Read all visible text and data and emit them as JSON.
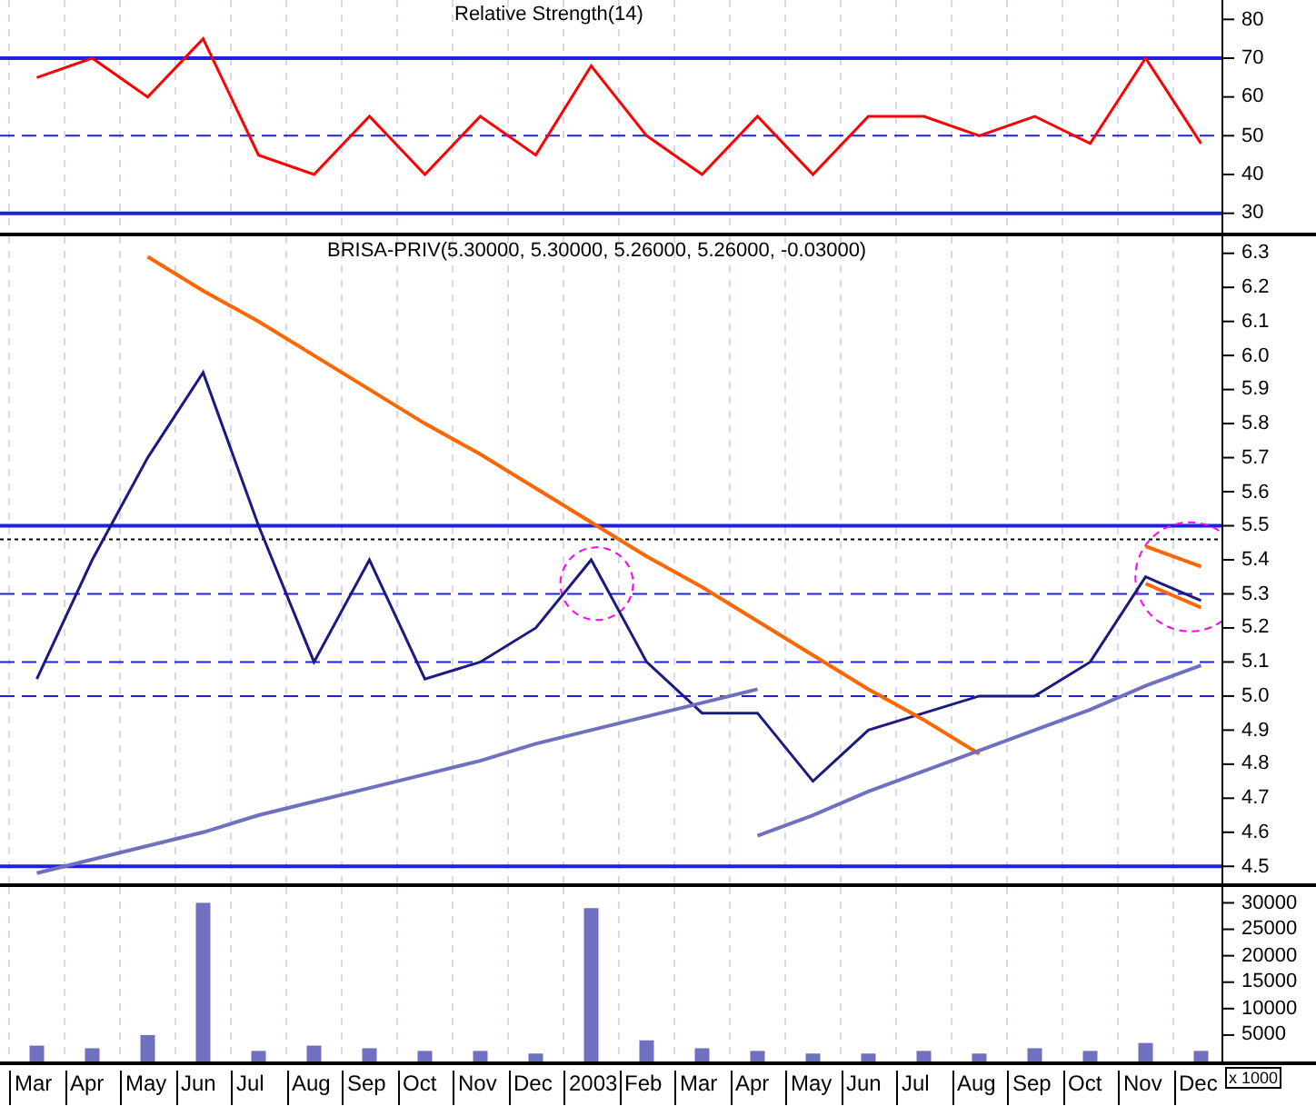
{
  "months": [
    "Mar",
    "Apr",
    "May",
    "Jun",
    "Jul",
    "Aug",
    "Sep",
    "Oct",
    "Nov",
    "Dec",
    "2003",
    "Feb",
    "Mar",
    "Apr",
    "May",
    "Jun",
    "Jul",
    "Aug",
    "Sep",
    "Oct",
    "Nov",
    "Dec"
  ],
  "rsi_panel": {
    "chart_data": {
      "type": "line",
      "title": "Relative Strength(14)",
      "ylim": [
        25,
        85
      ],
      "yticks": [
        30,
        40,
        50,
        60,
        70,
        80
      ],
      "grid": true,
      "ref_lines": [
        {
          "axis": "y",
          "value": 70
        },
        {
          "axis": "y",
          "value": 50
        },
        {
          "axis": "y",
          "value": 30
        }
      ],
      "series": [
        {
          "color": "#ff0000",
          "values": [
            65,
            70,
            60,
            75,
            45,
            40,
            55,
            40,
            55,
            45,
            68,
            50,
            40,
            55,
            40,
            55,
            55,
            50,
            55,
            48,
            70,
            48
          ]
        }
      ]
    }
  },
  "price_panel": {
    "chart_data": {
      "type": "line",
      "title": "BRISA-PRIV(5.30000, 5.30000, 5.26000, 5.26000, -0.03000)",
      "ylim": [
        4.45,
        6.35
      ],
      "yticks": [
        {
          "value": 4.5,
          "label": "4.5"
        },
        {
          "value": 4.6,
          "label": "4.6"
        },
        {
          "value": 4.7,
          "label": "4.7"
        },
        {
          "value": 4.8,
          "label": "4.8"
        },
        {
          "value": 4.9,
          "label": "4.9"
        },
        {
          "value": 5.0,
          "label": "5.0"
        },
        {
          "value": 5.1,
          "label": "5.1"
        },
        {
          "value": 5.2,
          "label": "5.2"
        },
        {
          "value": 5.3,
          "label": "5.3"
        },
        {
          "value": 5.4,
          "label": "5.4"
        },
        {
          "value": 5.5,
          "label": "5.5"
        },
        {
          "value": 5.6,
          "label": "5.6"
        },
        {
          "value": 5.7,
          "label": "5.7"
        },
        {
          "value": 5.8,
          "label": "5.8"
        },
        {
          "value": 5.9,
          "label": "5.9"
        },
        {
          "value": 6.0,
          "label": "6.0"
        },
        {
          "value": 6.1,
          "label": "6.1"
        },
        {
          "value": 6.2,
          "label": "6.2"
        },
        {
          "value": 6.3,
          "label": "6.3"
        }
      ],
      "grid": true,
      "ref_lines": [
        {
          "axis": "y",
          "value": 5.5
        },
        {
          "axis": "y",
          "value": 5.46
        },
        {
          "axis": "y",
          "value": 5.3
        },
        {
          "axis": "y",
          "value": 5.1
        },
        {
          "axis": "y",
          "value": 5.0
        },
        {
          "axis": "y",
          "value": 4.5
        }
      ],
      "series": [
        {
          "color": "#1a1a80",
          "values": [
            5.05,
            5.4,
            5.7,
            5.95,
            5.5,
            5.1,
            5.4,
            5.05,
            5.1,
            5.2,
            5.4,
            5.1,
            4.95,
            4.95,
            4.75,
            4.9,
            4.95,
            5.0,
            5.0,
            5.1,
            5.35,
            5.28
          ]
        },
        {
          "color": "#ff6600",
          "values": [
            null,
            null,
            6.29,
            6.19,
            6.1,
            6.0,
            5.9,
            5.8,
            5.71,
            5.61,
            5.51,
            5.41,
            5.32,
            5.22,
            5.12,
            5.02,
            4.93,
            4.83,
            null,
            null,
            null,
            null
          ]
        },
        {
          "color": "#7070c0",
          "values": [
            4.48,
            4.52,
            4.56,
            4.6,
            4.65,
            4.69,
            4.73,
            4.77,
            4.81,
            4.86,
            4.9,
            4.94,
            4.98,
            5.02,
            null,
            null,
            null,
            null,
            null,
            null,
            null,
            null
          ]
        },
        {
          "color": "#7070c0",
          "values": [
            null,
            null,
            null,
            null,
            null,
            null,
            null,
            null,
            null,
            null,
            null,
            null,
            null,
            4.59,
            4.65,
            4.72,
            4.78,
            4.84,
            4.9,
            4.96,
            5.03,
            5.09
          ]
        },
        {
          "color": "#ff6600",
          "values": [
            null,
            null,
            null,
            null,
            null,
            null,
            null,
            null,
            null,
            null,
            null,
            null,
            null,
            null,
            null,
            null,
            null,
            null,
            null,
            null,
            5.44,
            5.38
          ]
        },
        {
          "color": "#ff6600",
          "values": [
            null,
            null,
            null,
            null,
            null,
            null,
            null,
            null,
            null,
            null,
            null,
            null,
            null,
            null,
            null,
            null,
            null,
            null,
            null,
            null,
            5.33,
            5.26
          ]
        }
      ]
    }
  },
  "volume_panel": {
    "chart_data": {
      "type": "bar",
      "ylabel": "x 1000",
      "ylim": [
        0,
        33000
      ],
      "yticks": [
        5000,
        10000,
        15000,
        20000,
        25000,
        30000
      ],
      "grid": true,
      "series": [
        {
          "color": "#7070c0",
          "values": [
            3000,
            2500,
            5000,
            30000,
            2000,
            3000,
            2500,
            2000,
            2000,
            1500,
            29000,
            4000,
            2500,
            2000,
            1500,
            1500,
            2000,
            1500,
            2500,
            2000,
            3500,
            2000
          ]
        }
      ]
    }
  }
}
